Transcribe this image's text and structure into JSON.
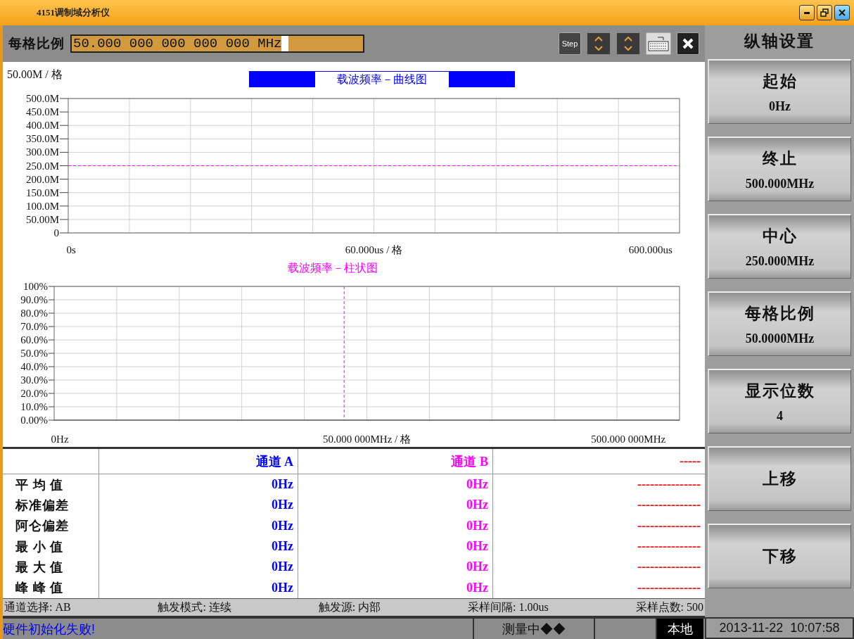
{
  "window": {
    "title": "4151调制域分析仪"
  },
  "toolbar": {
    "label": "每格比例",
    "value": "50.000 000 000 000 000 MHz",
    "step_button": "Step"
  },
  "line_chart": {
    "scale_label": "50.00M / 格",
    "chart_data": {
      "type": "line",
      "title": "载波频率－曲线图",
      "xlabel": "60.000us / 格",
      "x": [
        -3,
        630
      ],
      "xlim": [
        -3,
        630
      ],
      "ylim": [
        0,
        500
      ],
      "grid": true,
      "series": [
        {
          "color": "#ff00ff",
          "line_style": "dashed",
          "values": [
            250,
            250
          ]
        }
      ],
      "xticks": [
        {
          "value": 0,
          "label": "0s"
        },
        {
          "value": 600,
          "label": "600.000us"
        }
      ],
      "yticks": [
        {
          "value": 500,
          "label": "500.0M"
        },
        {
          "value": 450,
          "label": "450.0M"
        },
        {
          "value": 400,
          "label": "400.0M"
        },
        {
          "value": 350,
          "label": "350.0M"
        },
        {
          "value": 300,
          "label": "300.0M"
        },
        {
          "value": 250,
          "label": "250.0M"
        },
        {
          "value": 200,
          "label": "200.0M"
        },
        {
          "value": 150,
          "label": "150.0M"
        },
        {
          "value": 100,
          "label": "100.0M"
        },
        {
          "value": 50,
          "label": "50.00M"
        },
        {
          "value": 0,
          "label": "0"
        }
      ]
    }
  },
  "histogram": {
    "chart_data": {
      "type": "bar",
      "title": "载波频率－柱状图",
      "xlabel": "50.000 000MHz / 格",
      "xlim": [
        -5,
        545
      ],
      "ylim": [
        0,
        100
      ],
      "grid": true,
      "xticks": [
        {
          "value": 0,
          "label": "0Hz"
        },
        {
          "value": 500,
          "label": "500.000 000MHz"
        }
      ],
      "yticks": [
        {
          "value": 100,
          "label": "100%"
        },
        {
          "value": 90,
          "label": "90.0%"
        },
        {
          "value": 80,
          "label": "80.0%"
        },
        {
          "value": 70,
          "label": "70.0%"
        },
        {
          "value": 60,
          "label": "60.0%"
        },
        {
          "value": 50,
          "label": "50.0%"
        },
        {
          "value": 40,
          "label": "40.0%"
        },
        {
          "value": 30,
          "label": "30.0%"
        },
        {
          "value": 20,
          "label": "20.0%"
        },
        {
          "value": 10,
          "label": "10.0%"
        },
        {
          "value": 0,
          "label": "0.00%"
        }
      ],
      "ref_lines": [
        {
          "axis": "x",
          "value": 250,
          "color": "#ff00ff",
          "line_style": "dashed"
        }
      ]
    }
  },
  "table": {
    "columns": [
      {
        "label": "通道 A",
        "color": "#0000ff"
      },
      {
        "label": "通道 B",
        "color": "#ff00ff"
      },
      {
        "label": "-----",
        "color": "#ff0000"
      }
    ],
    "rows": [
      {
        "label": "平 均 值",
        "values": [
          "0Hz",
          "0Hz",
          "---------------"
        ]
      },
      {
        "label": "标准偏差",
        "values": [
          "0Hz",
          "0Hz",
          "---------------"
        ]
      },
      {
        "label": "阿仑偏差",
        "values": [
          "0Hz",
          "0Hz",
          "---------------"
        ]
      },
      {
        "label": "最 小 值",
        "values": [
          "0Hz",
          "0Hz",
          "---------------"
        ]
      },
      {
        "label": "最 大 值",
        "values": [
          "0Hz",
          "0Hz",
          "---------------"
        ]
      },
      {
        "label": "峰 峰 值",
        "values": [
          "0Hz",
          "0Hz",
          "---------------"
        ]
      }
    ]
  },
  "info_bar": [
    "通道选择: AB",
    "触发模式: 连续",
    "触发源: 内部",
    "采样间隔: 1.00us",
    "采样点数: 500"
  ],
  "status_bar": {
    "message": "硬件初始化失败!",
    "measuring": "测量中◆◆",
    "mode": "本地",
    "datetime": "2013-11-22  10:07:58"
  },
  "side_panel": {
    "title": "纵轴设置",
    "buttons": [
      {
        "label": "起始",
        "value": "0Hz"
      },
      {
        "label": "终止",
        "value": "500.000MHz"
      },
      {
        "label": "中心",
        "value": "250.000MHz"
      },
      {
        "label": "每格比例",
        "value": "50.0000MHz"
      },
      {
        "label": "显示位数",
        "value": "4"
      },
      {
        "label": "上移"
      },
      {
        "label": "下移"
      }
    ]
  }
}
